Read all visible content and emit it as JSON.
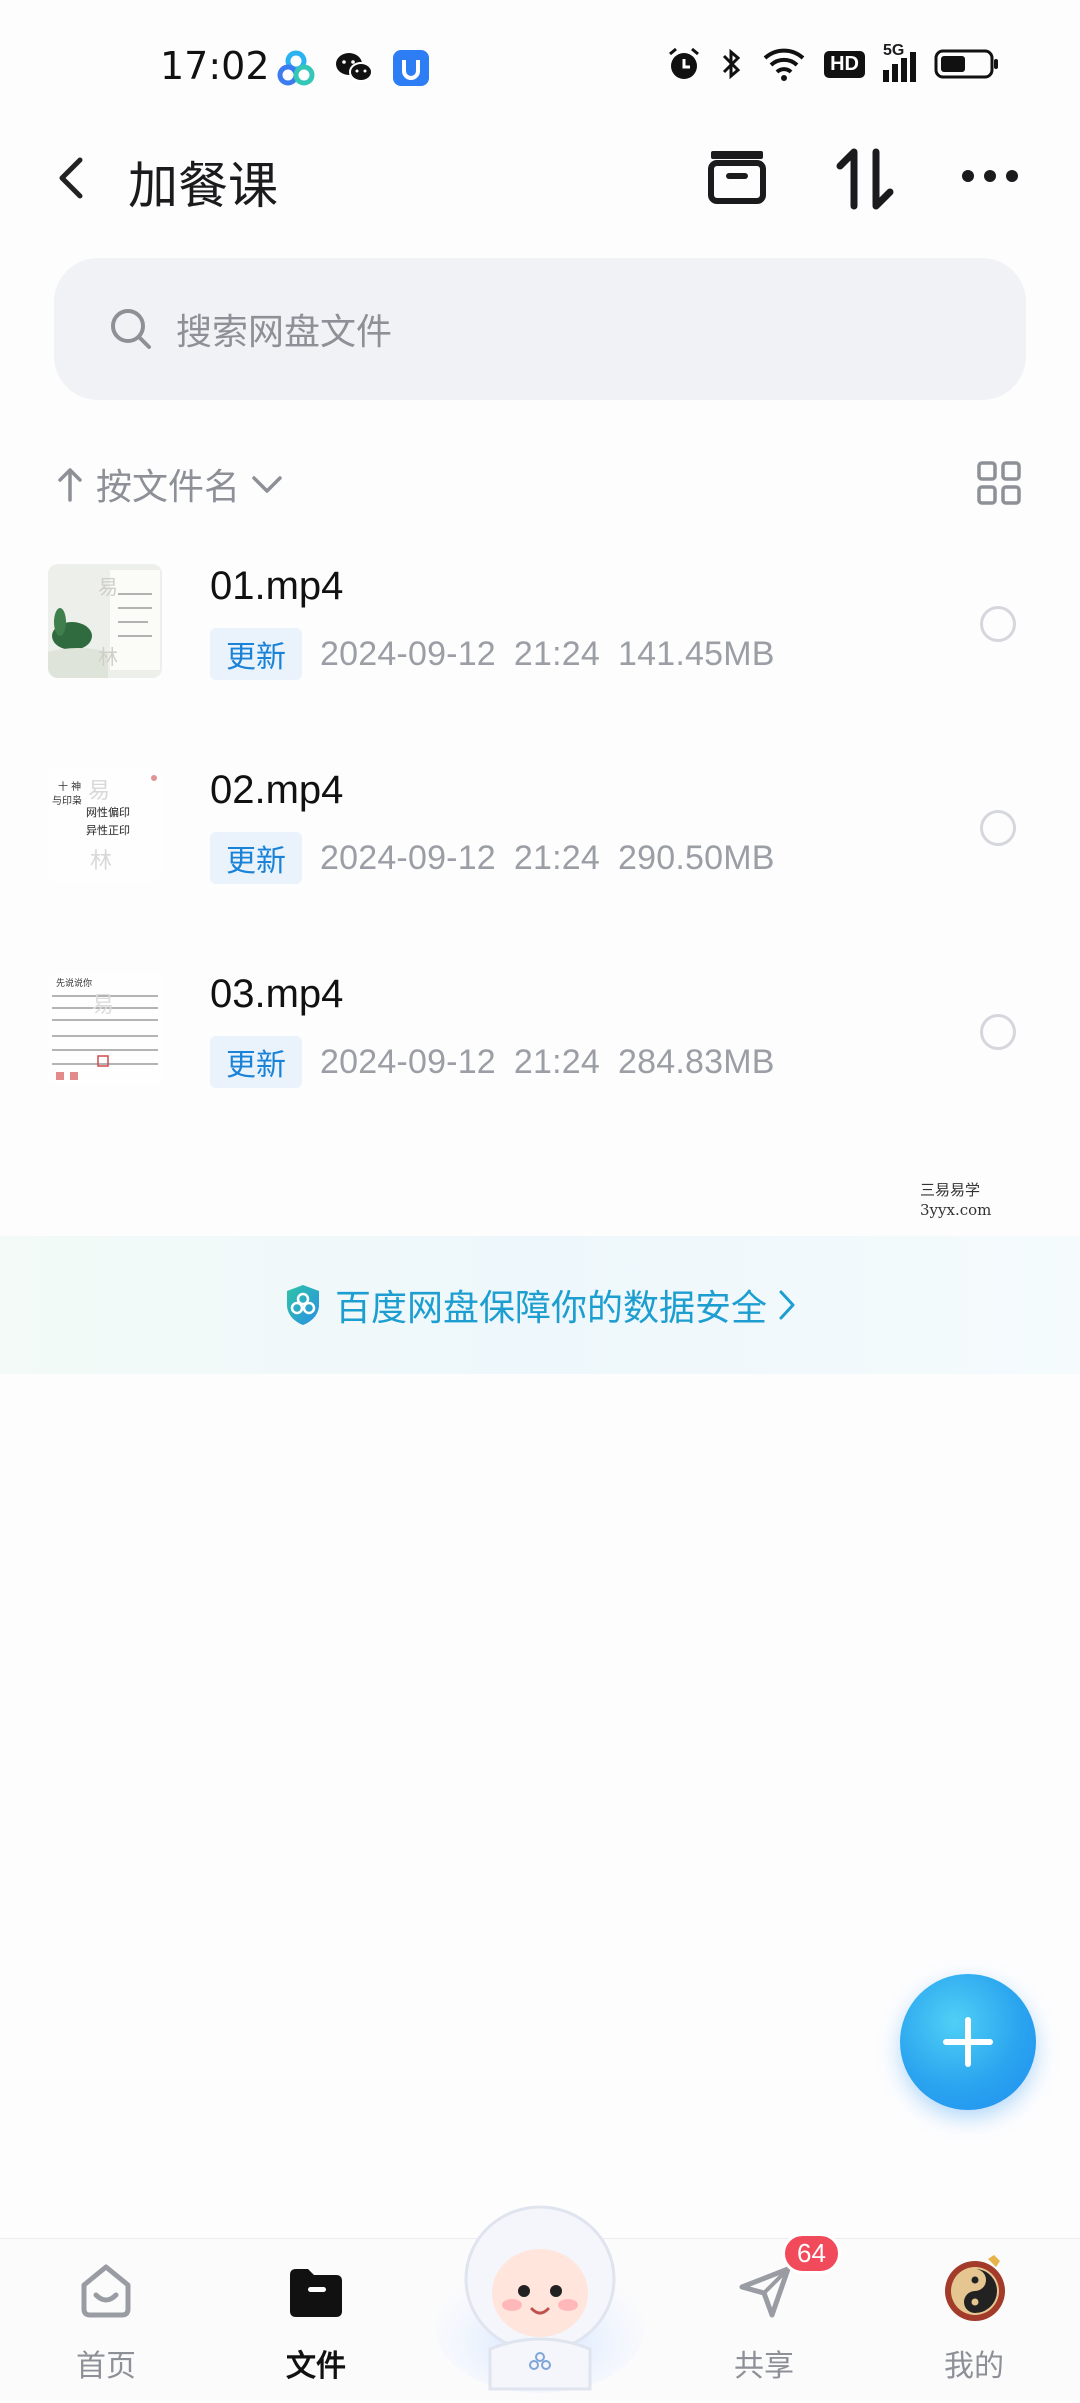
{
  "status_bar": {
    "time": "17:02",
    "network": "5G",
    "hd": "HD"
  },
  "header": {
    "title": "加餐课"
  },
  "search": {
    "placeholder": "搜索网盘文件"
  },
  "sort": {
    "label": "按文件名"
  },
  "files": [
    {
      "name": "01.mp4",
      "tag": "更新",
      "date": "2024-09-12",
      "time": "21:24",
      "size": "141.45MB"
    },
    {
      "name": "02.mp4",
      "tag": "更新",
      "date": "2024-09-12",
      "time": "21:24",
      "size": "290.50MB"
    },
    {
      "name": "03.mp4",
      "tag": "更新",
      "date": "2024-09-12",
      "time": "21:24",
      "size": "284.83MB"
    }
  ],
  "watermark": {
    "line1": "三易易学",
    "line2": "3yyx.com"
  },
  "banner": {
    "text": "百度网盘保障你的数据安全"
  },
  "nav": {
    "home": "首页",
    "files": "文件",
    "share": "共享",
    "share_badge": "64",
    "mine": "我的"
  },
  "colors": {
    "accent": "#1a83d8",
    "banner_text": "#1d9ed0",
    "fab": "#2aa4ef",
    "badge": "#f14a5a"
  }
}
